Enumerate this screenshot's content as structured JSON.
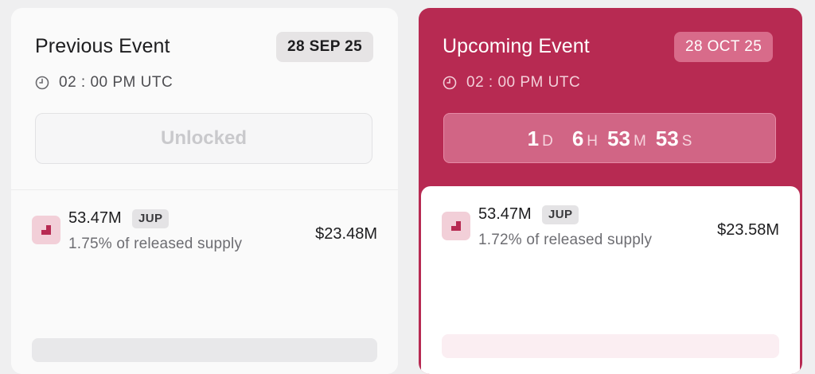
{
  "previous": {
    "title": "Previous Event",
    "date": "28 SEP 25",
    "time": "02 : 00 PM UTC",
    "status_label": "Unlocked",
    "token": {
      "amount": "53.47M",
      "symbol": "JUP",
      "supply_text": "1.75% of released supply",
      "value": "$23.48M"
    }
  },
  "upcoming": {
    "title": "Upcoming Event",
    "date": "28 OCT 25",
    "time": "02 : 00 PM UTC",
    "countdown": {
      "days": "1",
      "days_label": "D",
      "hours": "6",
      "hours_label": "H",
      "minutes": "53",
      "minutes_label": "M",
      "seconds": "53",
      "seconds_label": "S"
    },
    "token": {
      "amount": "53.47M",
      "symbol": "JUP",
      "supply_text": "1.72% of released supply",
      "value": "$23.58M"
    }
  },
  "icons": {
    "time": "clock-icon",
    "token": "jup-token-logo"
  },
  "colors": {
    "accent": "#b72a52",
    "accent_light": "#d16585",
    "card_bg": "#fafafa"
  }
}
